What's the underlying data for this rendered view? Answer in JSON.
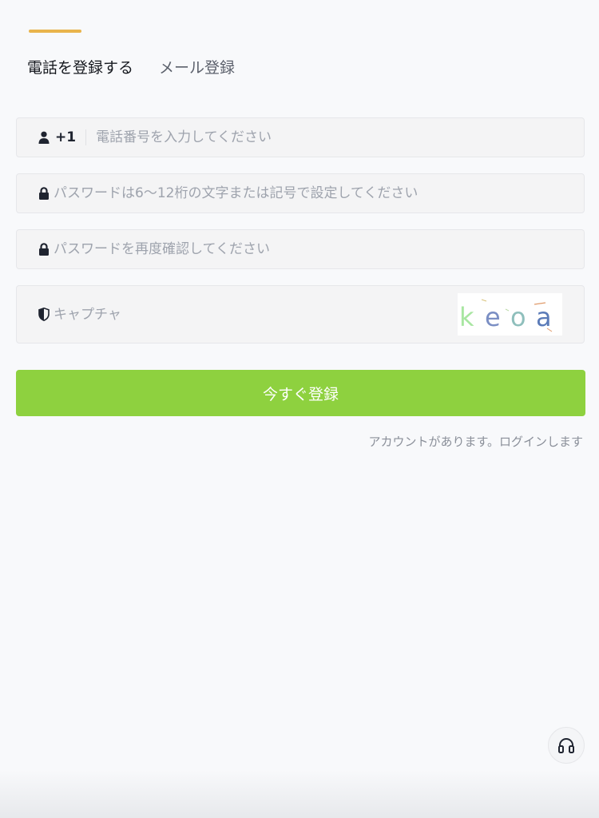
{
  "tabs": [
    {
      "label": "電話を登録する",
      "active": true
    },
    {
      "label": "メール登録",
      "active": false
    }
  ],
  "form": {
    "phone": {
      "country_code": "+1",
      "placeholder": "電話番号を入力してください",
      "icon": "user-icon"
    },
    "password": {
      "placeholder": "パスワードは6〜12桁の文字または記号で設定してください",
      "icon": "lock-icon"
    },
    "confirm_password": {
      "placeholder": "パスワードを再度確認してください",
      "icon": "lock-icon"
    },
    "captcha": {
      "placeholder": "キャプチャ",
      "icon": "shield-icon",
      "code": [
        "k",
        "e",
        "o",
        "a"
      ]
    }
  },
  "submit_label": "今すぐ登録",
  "login_link": "アカウントがあります。ログインします",
  "support_icon": "headset-icon",
  "colors": {
    "accent_underline": "#e9b44c",
    "submit_button": "#8ed13f",
    "captcha_letters": [
      "#a8e6a1",
      "#7b8fc4",
      "#8fbfbc",
      "#5b7bb8"
    ]
  }
}
